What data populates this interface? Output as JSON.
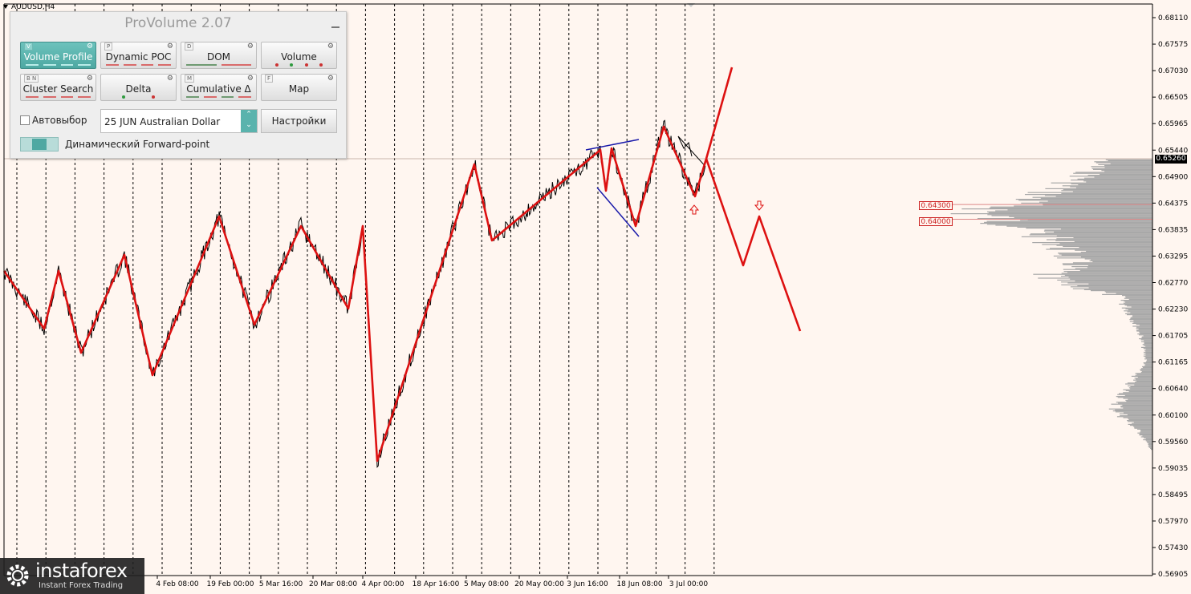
{
  "chart": {
    "symbol": "AUDUSD,H4",
    "current_price": "0.65260",
    "price_labels": [
      "0.68110",
      "0.67575",
      "0.67030",
      "0.66505",
      "0.65965",
      "0.65440",
      "0.64900",
      "0.64375",
      "0.63835",
      "0.63295",
      "0.62770",
      "0.62230",
      "0.61705",
      "0.61165",
      "0.60640",
      "0.60100",
      "0.59560",
      "0.59035",
      "0.58495",
      "0.57970",
      "0.57430",
      "0.56905"
    ],
    "time_labels": [
      "4 Feb 08:00",
      "19 Feb 00:00",
      "5 Mar 16:00",
      "20 Mar 08:00",
      "4 Apr 00:00",
      "18 Apr 16:00",
      "5 May 08:00",
      "20 May 00:00",
      "3 Jun 16:00",
      "18 Jun 08:00",
      "3 Jul 00:00"
    ],
    "levels": [
      {
        "label": "0.64300",
        "price": 0.643
      },
      {
        "label": "0.64000",
        "price": 0.64
      }
    ],
    "colors": {
      "background": "#fff6f0",
      "price_line": "#000000",
      "zigzag": "#dd1111",
      "forecast": "#dd1111",
      "triangle": "#1a1aaa",
      "profile": "#a8a8a8",
      "grid": "#000000"
    }
  },
  "panel": {
    "title": "ProVolume 2.07",
    "modules": [
      {
        "label": "Volume Profile",
        "hotkey": "V",
        "active": true
      },
      {
        "label": "Dynamic POC",
        "hotkey": "P",
        "active": false
      },
      {
        "label": "DOM",
        "hotkey": "D",
        "active": false
      },
      {
        "label": "Volume",
        "hotkey": "",
        "active": false
      },
      {
        "label": "Cluster Search",
        "hotkey": "B N",
        "active": false
      },
      {
        "label": "Delta",
        "hotkey": "",
        "active": false
      },
      {
        "label": "Cumulative Δ",
        "hotkey": "M",
        "active": false
      },
      {
        "label": "Map",
        "hotkey": "F",
        "active": false
      }
    ],
    "auto_select_label": "Автовыбор",
    "contract_value": "25 JUN Australian Dollar",
    "settings_label": "Настройки",
    "forward_point_label": "Динамический Forward-point"
  },
  "watermark": {
    "brand": "instaforex",
    "tagline": "Instant Forex Trading"
  }
}
